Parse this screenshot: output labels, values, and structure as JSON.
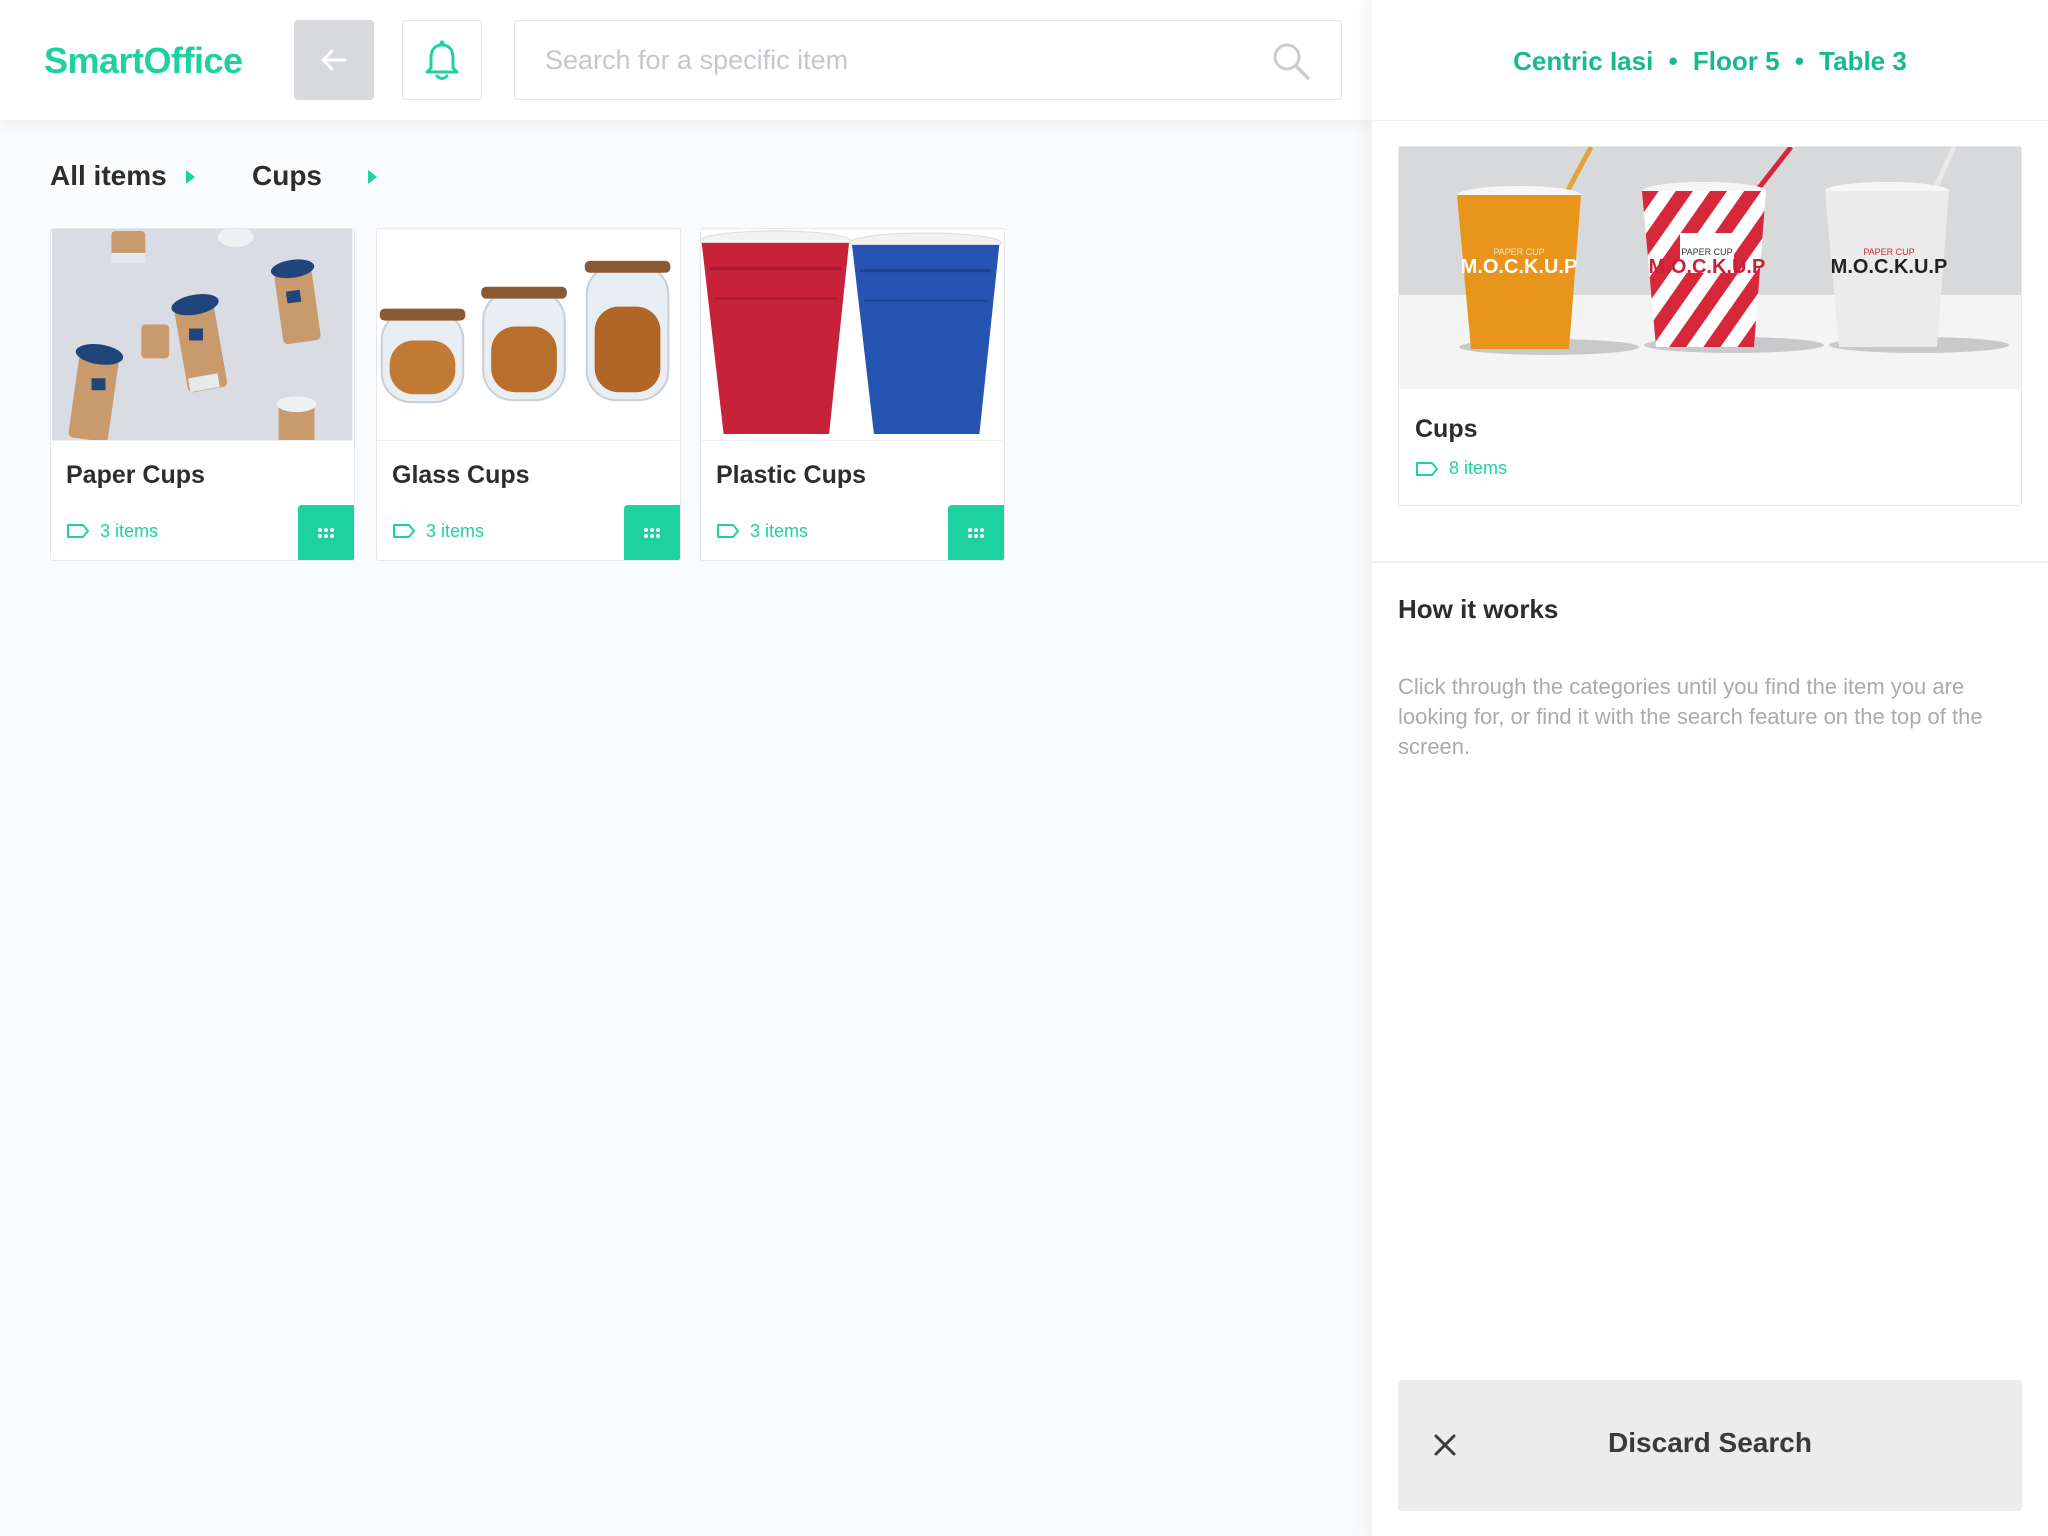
{
  "app": {
    "brand": "SmartOffice"
  },
  "header": {
    "search_placeholder": "Search for a specific item"
  },
  "breadcrumb": [
    {
      "label": "All items"
    },
    {
      "label": "Cups"
    }
  ],
  "cards": [
    {
      "title": "Paper Cups",
      "count": "3 items"
    },
    {
      "title": "Glass Cups",
      "count": "3 items"
    },
    {
      "title": "Plastic Cups",
      "count": "3 items"
    }
  ],
  "panel": {
    "location": {
      "place": "Centric Iasi",
      "floor": "Floor 5",
      "table": "Table 3",
      "separator": "•"
    },
    "feature": {
      "title": "Cups",
      "count": "8 items",
      "mockup_lines": [
        "PAPER CUP",
        "M.O.C.K.U.P"
      ]
    },
    "how_title": "How it works",
    "how_text": "Click through the categories until you find the item you are looking for, or find it with the search feature on the top of the screen.",
    "discard_label": "Discard Search"
  },
  "colors": {
    "accent": "#1dd1a1",
    "accent_dark": "#17b98e",
    "background": "#fafbfd"
  },
  "icons": [
    "arrow-left-icon",
    "bell-icon",
    "search-icon",
    "tag-icon",
    "grid-dots-icon",
    "close-icon",
    "chevron-right-icon"
  ]
}
